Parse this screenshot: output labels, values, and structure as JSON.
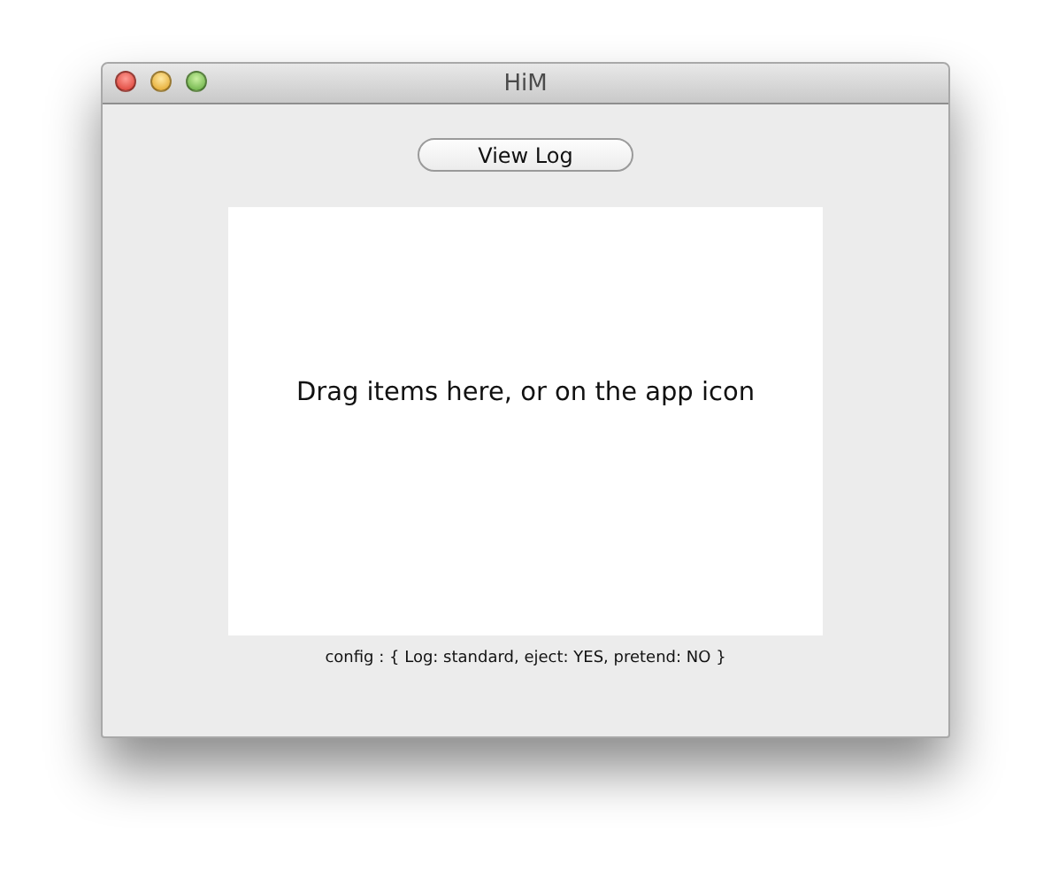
{
  "window": {
    "title": "HiM"
  },
  "button": {
    "label": "View Log"
  },
  "drop_area": {
    "text": "Drag items here, or on the app icon"
  },
  "status_text": "config : { Log: standard, eject: YES, pretend: NO }"
}
